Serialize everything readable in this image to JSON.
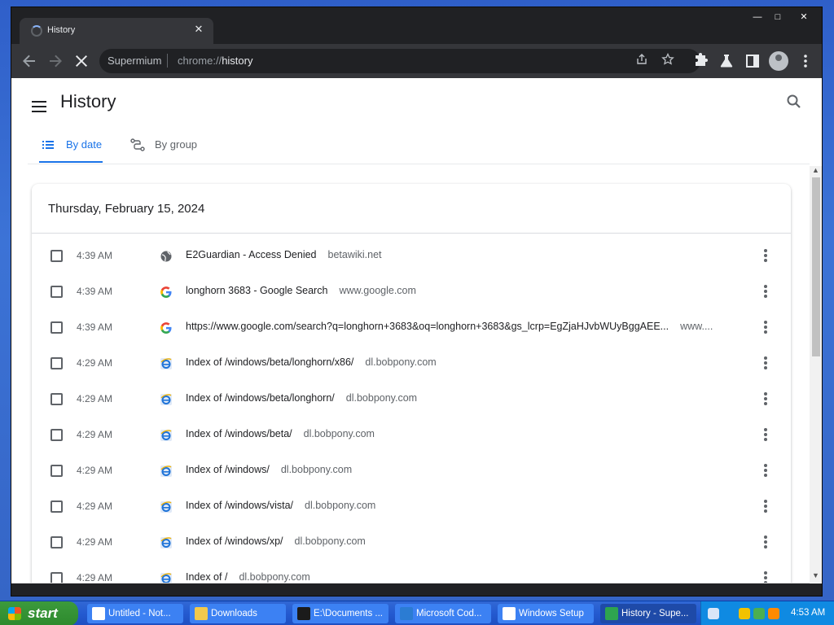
{
  "browser": {
    "tab_title": "History",
    "tab_close": "✕",
    "window_controls": [
      "—",
      "□",
      "✕"
    ],
    "omnibox": {
      "site": "Supermium",
      "url_prefix": "chrome://",
      "url_path": "history"
    }
  },
  "page": {
    "title": "History",
    "tabs": [
      {
        "label": "By date",
        "active": true
      },
      {
        "label": "By group",
        "active": false
      }
    ],
    "date_header": "Thursday, February 15, 2024",
    "rows": [
      {
        "time": "4:39 AM",
        "favicon": "globe-icon",
        "title": "E2Guardian - Access Denied",
        "domain": "betawiki.net"
      },
      {
        "time": "4:39 AM",
        "favicon": "google-icon",
        "title": "longhorn 3683 - Google Search",
        "domain": "www.google.com"
      },
      {
        "time": "4:39 AM",
        "favicon": "google-icon",
        "title": "https://www.google.com/search?q=longhorn+3683&oq=longhorn+3683&gs_lcrp=EgZjaHJvbWUyBggAEE...",
        "domain": "www...."
      },
      {
        "time": "4:29 AM",
        "favicon": "ie-icon",
        "title": "Index of /windows/beta/longhorn/x86/",
        "domain": "dl.bobpony.com"
      },
      {
        "time": "4:29 AM",
        "favicon": "ie-icon",
        "title": "Index of /windows/beta/longhorn/",
        "domain": "dl.bobpony.com"
      },
      {
        "time": "4:29 AM",
        "favicon": "ie-icon",
        "title": "Index of /windows/beta/",
        "domain": "dl.bobpony.com"
      },
      {
        "time": "4:29 AM",
        "favicon": "ie-icon",
        "title": "Index of /windows/",
        "domain": "dl.bobpony.com"
      },
      {
        "time": "4:29 AM",
        "favicon": "ie-icon",
        "title": "Index of /windows/vista/",
        "domain": "dl.bobpony.com"
      },
      {
        "time": "4:29 AM",
        "favicon": "ie-icon",
        "title": "Index of /windows/xp/",
        "domain": "dl.bobpony.com"
      },
      {
        "time": "4:29 AM",
        "favicon": "ie-icon",
        "title": "Index of /",
        "domain": "dl.bobpony.com"
      }
    ]
  },
  "taskbar": {
    "start_label": "start",
    "items": [
      {
        "label": "Untitled - Not...",
        "active": false
      },
      {
        "label": "Downloads",
        "active": false
      },
      {
        "label": "E:\\Documents ...",
        "active": false
      },
      {
        "label": "Microsoft Cod...",
        "active": false
      },
      {
        "label": "Windows Setup",
        "active": false
      },
      {
        "label": "History - Supe...",
        "active": true
      }
    ],
    "clock": "4:53 AM"
  },
  "colors": {
    "accent": "#1a73e8",
    "chrome_dark": "#35363a",
    "taskbar": "#245ad0"
  }
}
